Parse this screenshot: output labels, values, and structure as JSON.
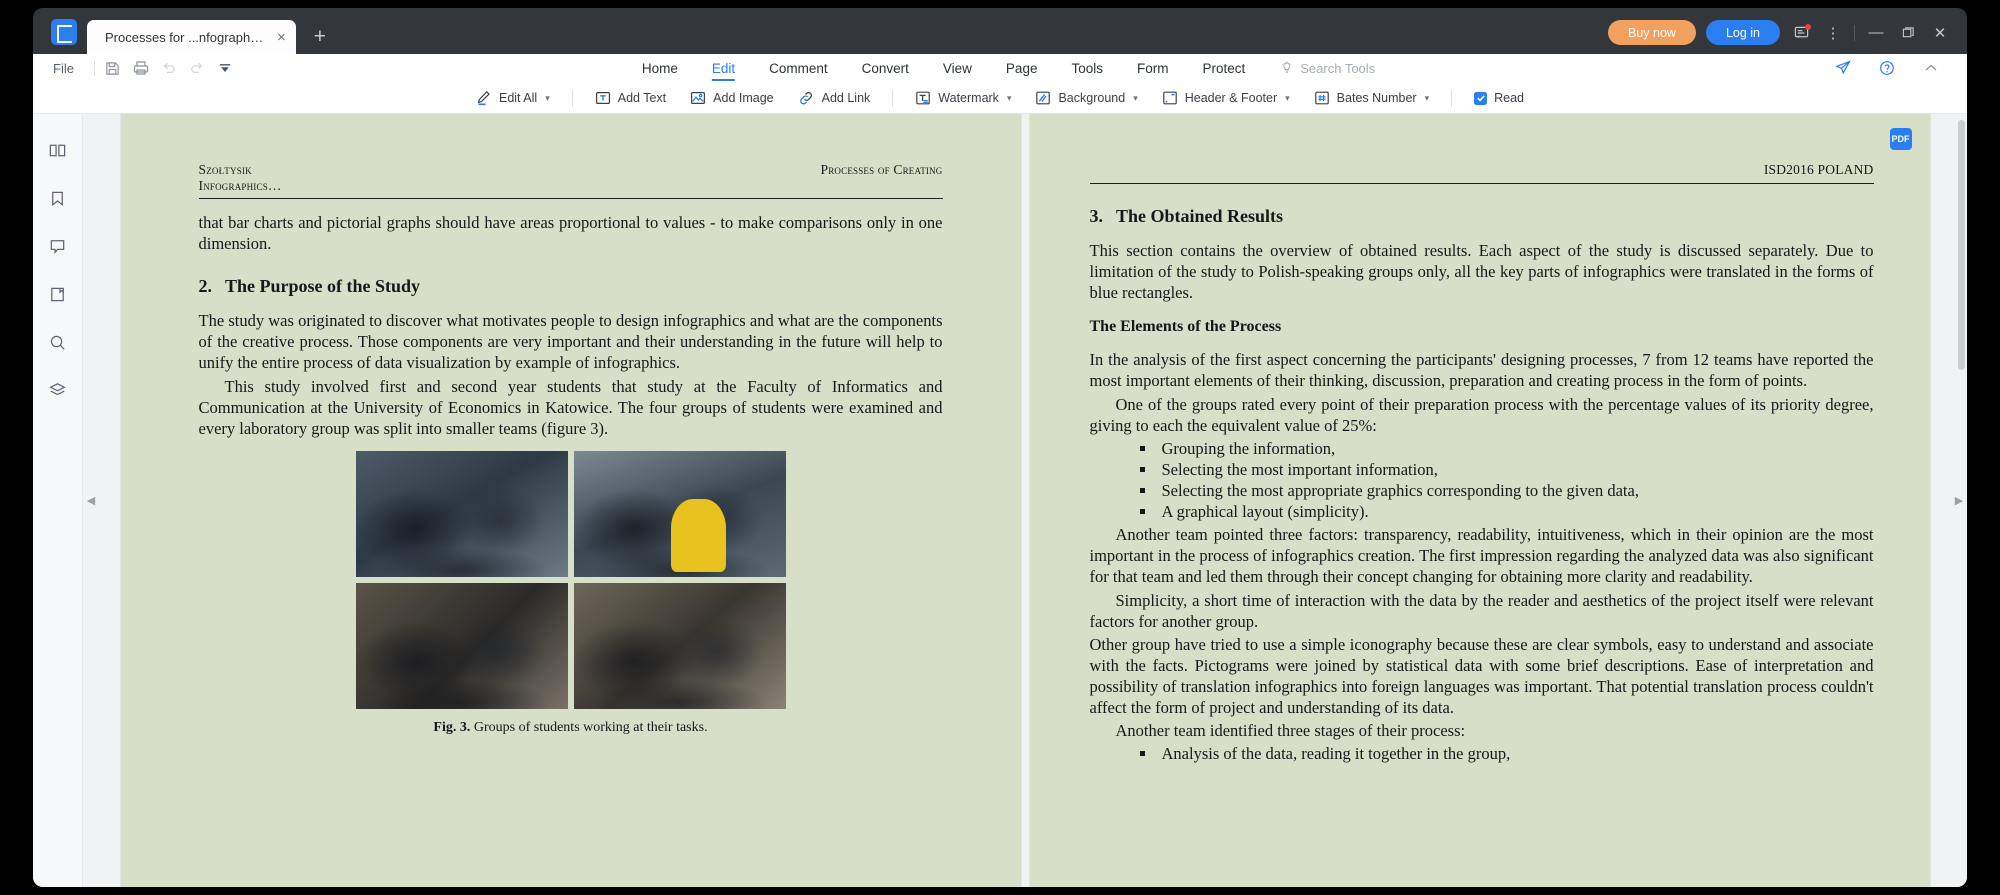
{
  "window": {
    "tab_title": "Processes  for ...nfographic.pdf",
    "tab_close": "×",
    "new_tab": "+",
    "buy_now": "Buy now",
    "log_in": "Log in",
    "minimize": "—",
    "restore": "❐",
    "close": "✕",
    "more": "⋮",
    "accent_blue": "#2a7ef0",
    "accent_orange": "#f2a05e",
    "notification_dot_color": "#e8453c"
  },
  "menubar": {
    "file": "File",
    "quick_icons": [
      "save-icon",
      "print-icon",
      "undo-icon",
      "redo-icon",
      "customize-icon"
    ],
    "tabs": [
      {
        "label": "Home",
        "active": false
      },
      {
        "label": "Edit",
        "active": true
      },
      {
        "label": "Comment",
        "active": false
      },
      {
        "label": "Convert",
        "active": false
      },
      {
        "label": "View",
        "active": false
      },
      {
        "label": "Page",
        "active": false
      },
      {
        "label": "Tools",
        "active": false
      },
      {
        "label": "Form",
        "active": false
      },
      {
        "label": "Protect",
        "active": false
      }
    ],
    "search_tools": "Search Tools",
    "right_icons": [
      "share-icon",
      "help-icon",
      "collapse-ribbon-icon"
    ]
  },
  "edit_toolbar": {
    "items": [
      {
        "label": "Edit All",
        "icon": "pencil-icon",
        "caret": true
      },
      {
        "label": "Add Text",
        "icon": "text-box-icon",
        "caret": false
      },
      {
        "label": "Add Image",
        "icon": "image-icon",
        "caret": false
      },
      {
        "label": "Add Link",
        "icon": "link-icon",
        "caret": false
      },
      {
        "label": "Watermark",
        "icon": "watermark-icon",
        "caret": true
      },
      {
        "label": "Background",
        "icon": "background-icon",
        "caret": true
      },
      {
        "label": "Header & Footer",
        "icon": "header-footer-icon",
        "caret": true
      },
      {
        "label": "Bates Number",
        "icon": "bates-number-icon",
        "caret": true
      }
    ],
    "read_label": "Read",
    "read_checked": true
  },
  "sidebar": {
    "items": [
      {
        "name": "thumbnails-panel",
        "icon": "thumbnails-icon"
      },
      {
        "name": "bookmarks-panel",
        "icon": "bookmark-icon"
      },
      {
        "name": "comments-panel",
        "icon": "comment-icon"
      },
      {
        "name": "attachments-panel",
        "icon": "attachment-icon"
      },
      {
        "name": "search-panel",
        "icon": "search-icon"
      },
      {
        "name": "layers-panel",
        "icon": "layers-icon"
      }
    ]
  },
  "viewer": {
    "prev_arrow": "◀",
    "next_arrow": "▶",
    "badge_label": "PDF"
  },
  "document": {
    "left_page": {
      "running_head_left_line1": "Szołtysik",
      "running_head_left_line2": "Infographics…",
      "running_head_right": "Processes of Creating",
      "paragraph_continued": "that bar charts and pictorial graphs should have areas proportional to values - to make comparisons only in one dimension.",
      "section_number": "2.",
      "section_title": "The Purpose of the Study",
      "paragraph_1": "The study was originated to discover what motivates people to design infographics and what are the components of the creative process. Those components are very important and their understanding in the future will help to unify the entire process of data visualization by example of infographics.",
      "paragraph_2": "This study involved first and second year students that study at the Faculty of Informatics and Communication at the University of Economics in Katowice. The four groups of students were examined and every laboratory group was split into smaller teams (figure 3).",
      "figure_label": "Fig. 3.",
      "figure_caption": "Groups of students working at their tasks."
    },
    "right_page": {
      "running_head_right": "ISD2016 POLAND",
      "section_number": "3.",
      "section_title": "The Obtained Results",
      "paragraph_1": "This section contains the overview of obtained results. Each aspect of the study is discussed separately. Due to limitation of the study to Polish-speaking groups only, all the key parts of infographics were translated in the forms of blue rectangles.",
      "subsection_title": "The Elements of the Process",
      "paragraph_2": "In the analysis of the first aspect concerning the participants' designing processes, 7 from 12 teams have reported the most important elements of their thinking, discussion, preparation and creating process in the form of points.",
      "paragraph_3": "One of the groups rated every point of their preparation process with the percentage values of its priority degree, giving to each the equivalent value of 25%:",
      "bullets_1": [
        "Grouping the information,",
        "Selecting the most important information,",
        "Selecting the most appropriate graphics corresponding to the given data,",
        "A graphical layout (simplicity)."
      ],
      "paragraph_4": "Another team pointed three factors: transparency, readability, intuitiveness, which in their opinion are the most important in the process of infographics creation. The first impression regarding the analyzed data was also significant for that team and led them through their concept changing for obtaining more clarity and readability.",
      "paragraph_5": "Simplicity, a short time of interaction with the data by the reader and aesthetics of the project itself were relevant factors for another group.",
      "paragraph_6": "Other group have tried to use a simple iconography because these are clear symbols, easy to understand and associate with the facts. Pictograms were joined by statistical data with some brief descriptions. Ease of interpretation and possibility of translation infographics into foreign languages was important. That potential translation process couldn't affect the form of project and understanding of its data.",
      "paragraph_7": "Another team identified three stages of their process:",
      "bullets_2": [
        "Analysis of the data, reading it together in the group,"
      ]
    }
  }
}
